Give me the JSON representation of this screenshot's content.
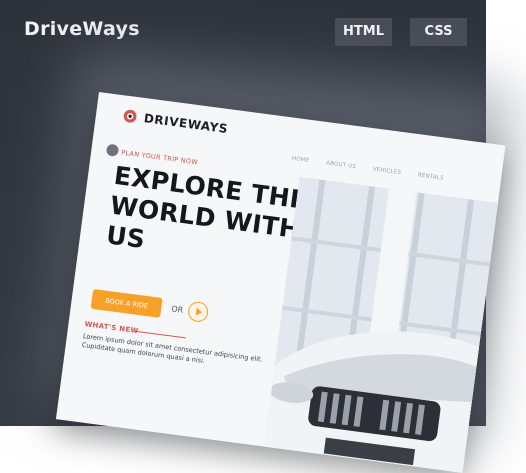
{
  "header": {
    "title": "DriveWays",
    "tag_html": "HTML",
    "tag_css": "CSS"
  },
  "mockup": {
    "logo_text": "DRIVEWAYS",
    "nav": [
      "HOME",
      "ABOUT US",
      "VEHICLES",
      "RENTALS"
    ],
    "kicker": "PLAN YOUR TRIP NOW",
    "headline_lines": [
      "EXPLORE THE",
      "WORLD WITH",
      "US"
    ],
    "cta_label": "BOOK A RIDE",
    "or_text": "OR",
    "section_title": "WHAT'S NEW",
    "section_text": "Lorem ipsum dolor sit amet consectetur adipisicing elit. Cupiditate quam dolorum quasi a nisi."
  },
  "colors": {
    "background": "#2d323b",
    "tag": "#474c56",
    "accent_orange": "#f7a12b",
    "accent_red": "#d9534f"
  }
}
